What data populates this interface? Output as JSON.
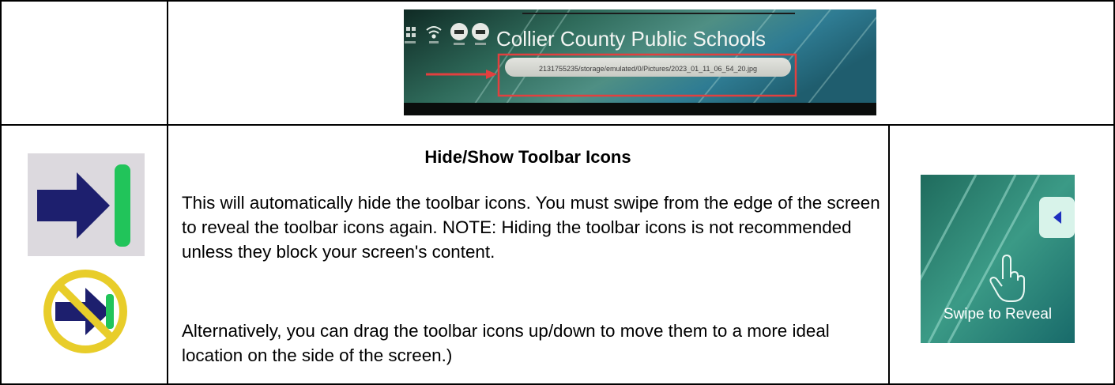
{
  "screenshot": {
    "banner_title": "Collier County Public Schools",
    "file_path": "2131755235/storage/emulated/0/Pictures/2023_01_11_06_54_20.jpg",
    "toolbar_icons": [
      "network-icon",
      "wifi-icon",
      "display-icon",
      "display-icon"
    ],
    "highlight_color": "#e2403f"
  },
  "section": {
    "heading": "Hide/Show Toolbar Icons",
    "paragraph_1": "This will automatically hide the toolbar icons. You must swipe from the edge of the screen to reveal the toolbar icons again. NOTE: Hiding the toolbar icons is not recommended unless they block your screen's content.",
    "paragraph_2": "Alternatively, you can drag the toolbar icons up/down to move them to a more ideal location on the side of the screen.)"
  },
  "icons": {
    "hide_toolbar": "arrow-to-bar-icon",
    "no_hide": "prohibited-arrow-icon",
    "arrow_color": "#1d1f6e",
    "bar_color": "#21c45a",
    "prohibit_color": "#e8cd2a"
  },
  "swipe_panel": {
    "caption": "Swipe to Reveal",
    "tab_icon": "chevron-left-icon",
    "gesture_icon": "hand-pointer-icon"
  }
}
